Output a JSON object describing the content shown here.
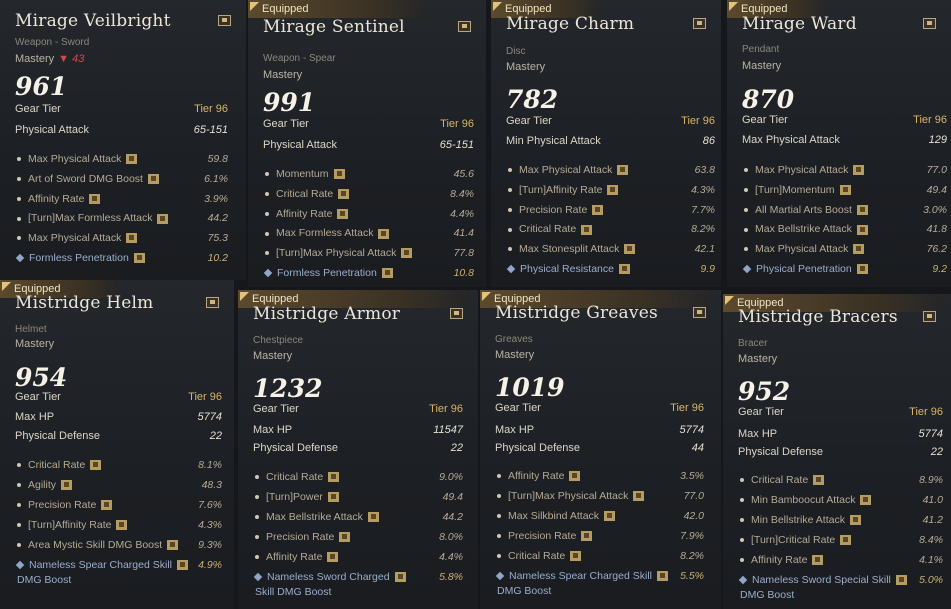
{
  "equipped_label": "Equipped",
  "labels": {
    "mastery": "Mastery",
    "gear_tier": "Gear Tier"
  },
  "cards": [
    {
      "name": "Mirage Veilbright",
      "type": "Weapon - Sword",
      "mastery_delta": "43",
      "score": "961",
      "tier": "Tier 96",
      "primary": [
        {
          "label": "Physical Attack",
          "value": "65-151"
        }
      ],
      "stats": [
        {
          "label": "Max Physical Attack",
          "value": "59.8"
        },
        {
          "label": "Art of Sword DMG Boost",
          "value": "6.1%"
        },
        {
          "label": "Affinity Rate",
          "value": "3.9%"
        },
        {
          "label": "[Turn]Max Formless Attack",
          "value": "44.2"
        },
        {
          "label": "Max Physical Attack",
          "value": "75.3"
        },
        {
          "label": "Formless Penetration",
          "value": "10.2"
        }
      ]
    },
    {
      "name": "Mirage Sentinel",
      "type": "Weapon - Spear",
      "score": "991",
      "tier": "Tier 96",
      "primary": [
        {
          "label": "Physical Attack",
          "value": "65-151"
        }
      ],
      "stats": [
        {
          "label": "Momentum",
          "value": "45.6"
        },
        {
          "label": "Critical Rate",
          "value": "8.4%"
        },
        {
          "label": "Affinity Rate",
          "value": "4.4%"
        },
        {
          "label": "Max Formless Attack",
          "value": "41.4"
        },
        {
          "label": "[Turn]Max Physical Attack",
          "value": "77.8"
        },
        {
          "label": "Formless Penetration",
          "value": "10.8"
        }
      ]
    },
    {
      "name": "Mirage Charm",
      "type": "Disc",
      "score": "782",
      "tier": "Tier 96",
      "primary": [
        {
          "label": "Min Physical Attack",
          "value": "86"
        }
      ],
      "stats": [
        {
          "label": "Max Physical Attack",
          "value": "63.8"
        },
        {
          "label": "[Turn]Affinity Rate",
          "value": "4.3%"
        },
        {
          "label": "Precision Rate",
          "value": "7.7%"
        },
        {
          "label": "Critical Rate",
          "value": "8.2%"
        },
        {
          "label": "Max Stonesplit Attack",
          "value": "42.1"
        },
        {
          "label": "Physical Resistance",
          "value": "9.9"
        }
      ]
    },
    {
      "name": "Mirage Ward",
      "type": "Pendant",
      "score": "870",
      "tier": "Tier 96",
      "primary": [
        {
          "label": "Max Physical Attack",
          "value": "129"
        }
      ],
      "stats": [
        {
          "label": "Max Physical Attack",
          "value": "77.0"
        },
        {
          "label": "[Turn]Momentum",
          "value": "49.4"
        },
        {
          "label": "All Martial Arts Boost",
          "value": "3.0%"
        },
        {
          "label": "Max Bellstrike Attack",
          "value": "41.8"
        },
        {
          "label": "Max Physical Attack",
          "value": "76.2"
        },
        {
          "label": "Physical Penetration",
          "value": "9.2"
        }
      ]
    },
    {
      "name": "Mistridge Helm",
      "type": "Helmet",
      "score": "954",
      "tier": "Tier 96",
      "primary": [
        {
          "label": "Max HP",
          "value": "5774"
        },
        {
          "label": "Physical Defense",
          "value": "22"
        }
      ],
      "stats": [
        {
          "label": "Critical Rate",
          "value": "8.1%"
        },
        {
          "label": "Agility",
          "value": "48.3"
        },
        {
          "label": "Precision Rate",
          "value": "7.6%"
        },
        {
          "label": "[Turn]Affinity Rate",
          "value": "4.3%"
        },
        {
          "label": "Area Mystic Skill DMG Boost",
          "value": "9.3%"
        },
        {
          "label": "Nameless Spear Charged Skill",
          "label2": "DMG Boost",
          "value": "4.9%"
        }
      ]
    },
    {
      "name": "Mistridge Armor",
      "type": "Chestpiece",
      "score": "1232",
      "tier": "Tier 96",
      "primary": [
        {
          "label": "Max HP",
          "value": "11547"
        },
        {
          "label": "Physical Defense",
          "value": "22"
        }
      ],
      "stats": [
        {
          "label": "Critical Rate",
          "value": "9.0%"
        },
        {
          "label": "[Turn]Power",
          "value": "49.4"
        },
        {
          "label": "Max Bellstrike Attack",
          "value": "44.2"
        },
        {
          "label": "Precision Rate",
          "value": "8.0%"
        },
        {
          "label": "Affinity Rate",
          "value": "4.4%"
        },
        {
          "label": "Nameless Sword Charged",
          "label2": "Skill DMG Boost",
          "value": "5.8%"
        }
      ]
    },
    {
      "name": "Mistridge Greaves",
      "type": "Greaves",
      "score": "1019",
      "tier": "Tier 96",
      "primary": [
        {
          "label": "Max HP",
          "value": "5774"
        },
        {
          "label": "Physical Defense",
          "value": "44"
        }
      ],
      "stats": [
        {
          "label": "Affinity Rate",
          "value": "3.5%"
        },
        {
          "label": "[Turn]Max Physical Attack",
          "value": "77.0"
        },
        {
          "label": "Max Silkbind Attack",
          "value": "42.0"
        },
        {
          "label": "Precision Rate",
          "value": "7.9%"
        },
        {
          "label": "Critical Rate",
          "value": "8.2%"
        },
        {
          "label": "Nameless Spear Charged Skill",
          "label2": "DMG Boost",
          "value": "5.5%"
        }
      ]
    },
    {
      "name": "Mistridge Bracers",
      "type": "Bracer",
      "score": "952",
      "tier": "Tier 96",
      "primary": [
        {
          "label": "Max HP",
          "value": "5774"
        },
        {
          "label": "Physical Defense",
          "value": "22"
        }
      ],
      "stats": [
        {
          "label": "Critical Rate",
          "value": "8.9%"
        },
        {
          "label": "Min Bamboocut Attack",
          "value": "41.0"
        },
        {
          "label": "Min Bellstrike Attack",
          "value": "41.2"
        },
        {
          "label": "[Turn]Critical Rate",
          "value": "8.4%"
        },
        {
          "label": "Affinity Rate",
          "value": "4.1%"
        },
        {
          "label": "Nameless Sword Special Skill",
          "label2": "DMG Boost",
          "value": "5.0%"
        }
      ]
    }
  ]
}
